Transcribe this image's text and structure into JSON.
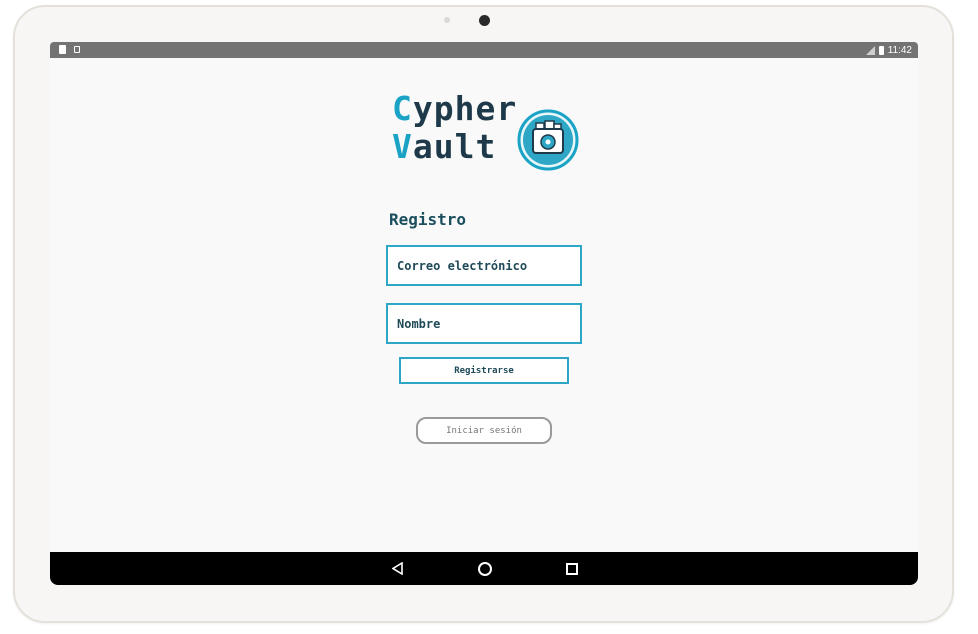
{
  "status_bar": {
    "time": "11:42",
    "icons": [
      "sim-card-icon",
      "notification-icon",
      "signal-icon",
      "battery-icon"
    ]
  },
  "logo": {
    "line1_initial": "C",
    "line1_rest": "ypher",
    "line2_initial": "V",
    "line2_rest": "ault",
    "icon": "vault-folder-icon"
  },
  "form": {
    "title": "Registro",
    "email_placeholder": "Correo electrónico",
    "name_placeholder": "Nombre",
    "register_label": "Registrarse",
    "login_label": "Iniciar sesión"
  },
  "nav_bar": {
    "icons": [
      "back-icon",
      "home-icon",
      "recents-icon"
    ]
  },
  "colors": {
    "accent": "#2ea7c6",
    "logo_dark": "#1e3a4a",
    "logo_accent": "#1aa3c4",
    "text_dark": "#1f4a58"
  }
}
